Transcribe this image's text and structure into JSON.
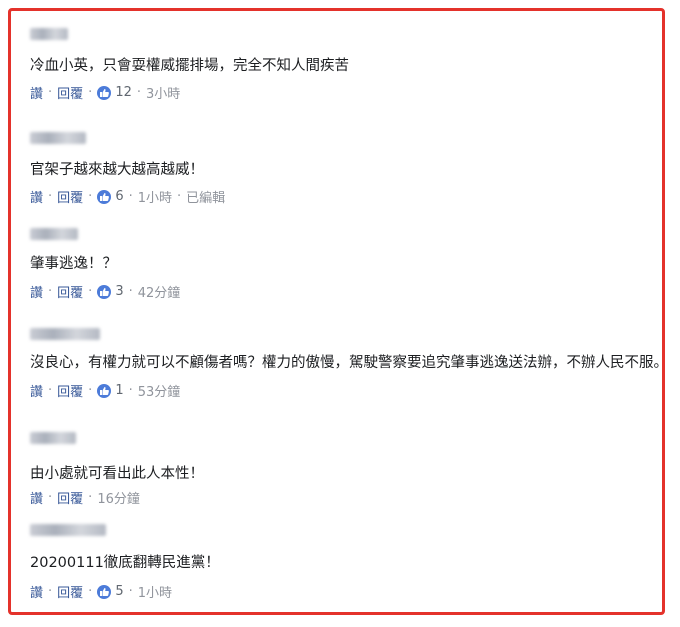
{
  "colors": {
    "frame": "#e4322b",
    "link": "#385898",
    "muted": "#90949c",
    "like": "#4c7bd9"
  },
  "actions": {
    "like": "讚",
    "reply": "回覆",
    "separator": "·"
  },
  "comments": [
    {
      "text": "冷血小英，只會耍權威擺排場，完全不知人間疾苦",
      "likes": "12",
      "time": "3小時",
      "edited": ""
    },
    {
      "text": "官架子越來越大越高越威！",
      "likes": "6",
      "time": "1小時",
      "edited": "已編輯"
    },
    {
      "text": "肇事逃逸！？",
      "likes": "3",
      "time": "42分鐘",
      "edited": ""
    },
    {
      "text": "沒良心，有權力就可以不顧傷者嗎？權力的傲慢，駕駛警察要追究肇事逃逸送法辦，不辦人民不服。",
      "likes": "1",
      "time": "53分鐘",
      "edited": ""
    },
    {
      "text": "由小處就可看出此人本性！",
      "likes": "",
      "time": "16分鐘",
      "edited": ""
    },
    {
      "text": "20200111徹底翻轉民進黨！",
      "likes": "5",
      "time": "1小時",
      "edited": ""
    }
  ]
}
